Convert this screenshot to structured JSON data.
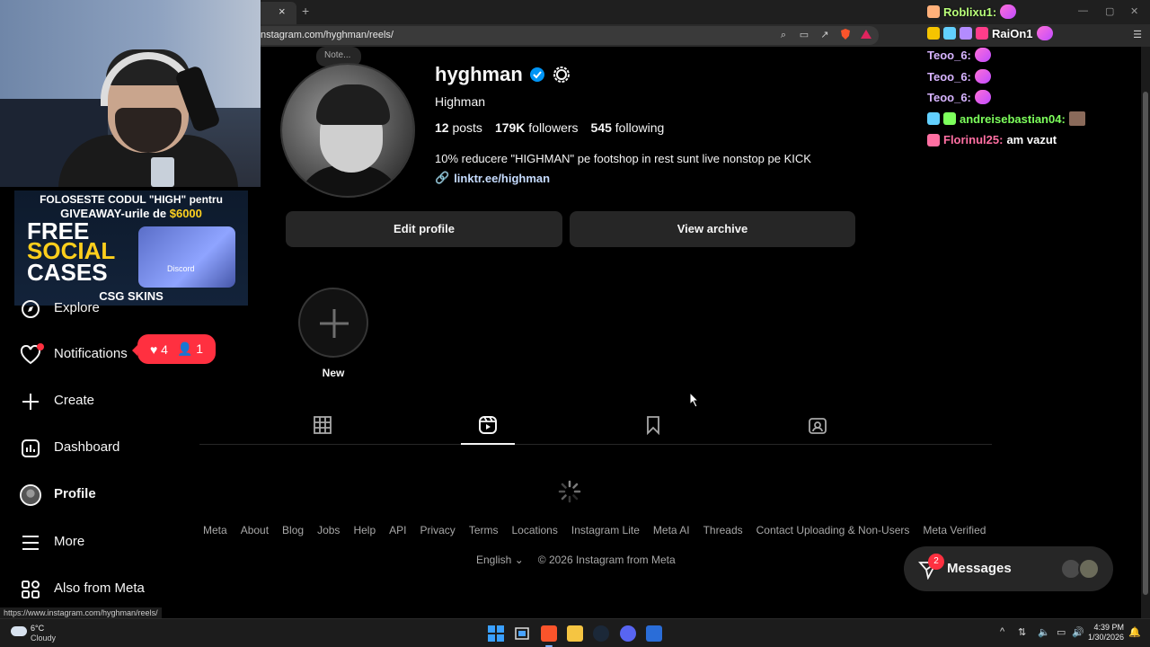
{
  "browser": {
    "url": "nstagram.com/hyghman/reels/",
    "tab_close": "×",
    "tab_new": "+",
    "status_url": "https://www.instagram.com/hyghman/reels/"
  },
  "stream_overlay": {
    "banner": {
      "line1": "FOLOSESTE CODUL \"HIGH\" pentru",
      "line2_prefix": "GIVEAWAY-urile de ",
      "line2_amount": "$6000",
      "free": "FREE",
      "social": "SOCIAL",
      "cases": "CASES",
      "box_label": "Discord",
      "brand": "CSG SKINS"
    },
    "chat": [
      {
        "user": "Roblixu1:",
        "message": "",
        "color": "#b9ff7a"
      },
      {
        "user": "RaiOn1",
        "message": "",
        "color": "#ffffff"
      },
      {
        "user": "Teoo_6:",
        "message": "",
        "color": "#d7b4ff"
      },
      {
        "user": "Teoo_6:",
        "message": "",
        "color": "#d7b4ff"
      },
      {
        "user": "Teoo_6:",
        "message": "",
        "color": "#d7b4ff"
      },
      {
        "user": "andreisebastian04:",
        "message": "",
        "color": "#7dff5c"
      },
      {
        "user": "Florinul25:",
        "message": "am vazut",
        "color": "#ff6fa2"
      }
    ]
  },
  "note": {
    "label": "Note..."
  },
  "nav": {
    "explore": "Explore",
    "notifications": "Notifications",
    "create": "Create",
    "dashboard": "Dashboard",
    "profile": "Profile",
    "more": "More",
    "also_from_meta": "Also from Meta",
    "notif_likes": "4",
    "notif_follows": "1"
  },
  "profile": {
    "username": "hyghman",
    "full_name": "Highman",
    "posts_count": "12",
    "posts_label": "posts",
    "followers_count": "179K",
    "followers_label": "followers",
    "following_count": "545",
    "following_label": "following",
    "bio": "10% reducere \"HIGHMAN\" pe footshop in rest sunt live nonstop pe KICK",
    "link": "linktr.ee/highman",
    "edit_profile": "Edit profile",
    "view_archive": "View archive",
    "highlight_new": "New",
    "active_tab": "reels"
  },
  "footer": {
    "links": [
      "Meta",
      "About",
      "Blog",
      "Jobs",
      "Help",
      "API",
      "Privacy",
      "Terms",
      "Locations",
      "Instagram Lite",
      "Meta AI",
      "Threads",
      "Contact Uploading & Non-Users",
      "Meta Verified"
    ],
    "language": "English",
    "copyright": "© 2026 Instagram from Meta"
  },
  "messages": {
    "label": "Messages",
    "badge": "2"
  },
  "taskbar": {
    "temp": "6°C",
    "weather": "Cloudy",
    "time": "4:39 PM",
    "date": "1/30/2026"
  },
  "colors": {
    "accent": "#0095f6",
    "badge": "#ff3040",
    "background": "#000000",
    "button": "#262626"
  }
}
